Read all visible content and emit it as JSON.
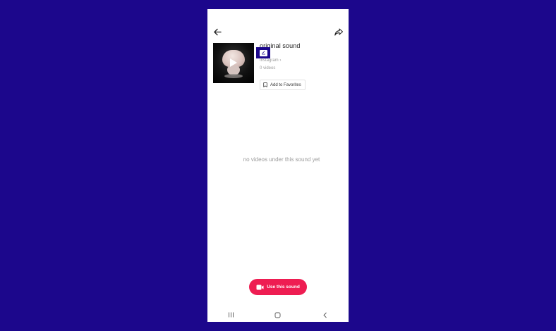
{
  "sound": {
    "title": "original sound",
    "author": "Instagram",
    "author_chevron": "›",
    "videos_count": "0 videos"
  },
  "actions": {
    "add_to_favorites": "Add to Favorites",
    "use_this_sound": "Use this sound"
  },
  "empty_state": {
    "message": "no videos under this sound yet"
  },
  "colors": {
    "background": "#1c078c",
    "accent": "#ee1d52"
  }
}
